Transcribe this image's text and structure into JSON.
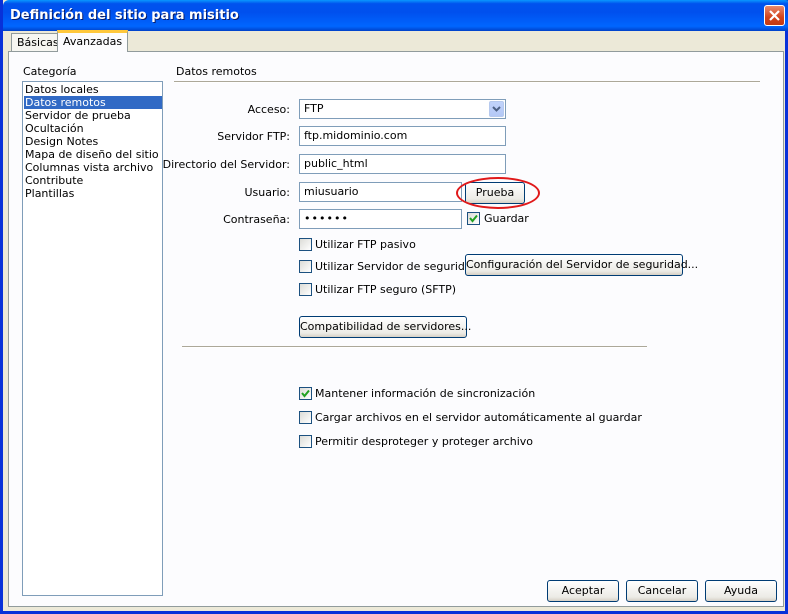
{
  "window": {
    "title": "Definición del sitio para misitio"
  },
  "tabs": [
    {
      "label": "Básicas"
    },
    {
      "label": "Avanzadas"
    }
  ],
  "category": {
    "label": "Categoría",
    "items": [
      "Datos locales",
      "Datos remotos",
      "Servidor de prueba",
      "Ocultación",
      "Design Notes",
      "Mapa de diseño del sitio",
      "Columnas vista archivo",
      "Contribute",
      "Plantillas"
    ],
    "selected": "Datos remotos"
  },
  "remote": {
    "section_title": "Datos remotos",
    "access_label": "Acceso:",
    "access_value": "FTP",
    "ftp_server_label": "Servidor FTP:",
    "ftp_server_value": "ftp.midominio.com",
    "server_dir_label": "Directorio del Servidor:",
    "server_dir_value": "public_html",
    "user_label": "Usuario:",
    "user_value": "miusuario",
    "test_button": "Prueba",
    "password_label": "Contraseña:",
    "password_value": "••••••",
    "save_label": "Guardar",
    "save_checked": true,
    "passive_label": "Utilizar FTP pasivo",
    "passive_checked": false,
    "firewall_label": "Utilizar Servidor de seguridad",
    "firewall_checked": false,
    "firewall_config_button": "Configuración del Servidor de seguridad...",
    "sftp_label": "Utilizar FTP seguro (SFTP)",
    "sftp_checked": false,
    "compat_button": "Compatibilidad de servidores...",
    "sync_label": "Mantener información de sincronización",
    "sync_checked": true,
    "autoupload_label": "Cargar archivos en el servidor automáticamente al guardar",
    "autoupload_checked": false,
    "checkout_label": "Permitir desproteger y proteger archivo",
    "checkout_checked": false
  },
  "footer": {
    "ok": "Aceptar",
    "cancel": "Cancelar",
    "help": "Ayuda"
  },
  "colors": {
    "titlebar": "#0054e3",
    "selection": "#316ac5",
    "highlight_ellipse": "#e0191a"
  }
}
